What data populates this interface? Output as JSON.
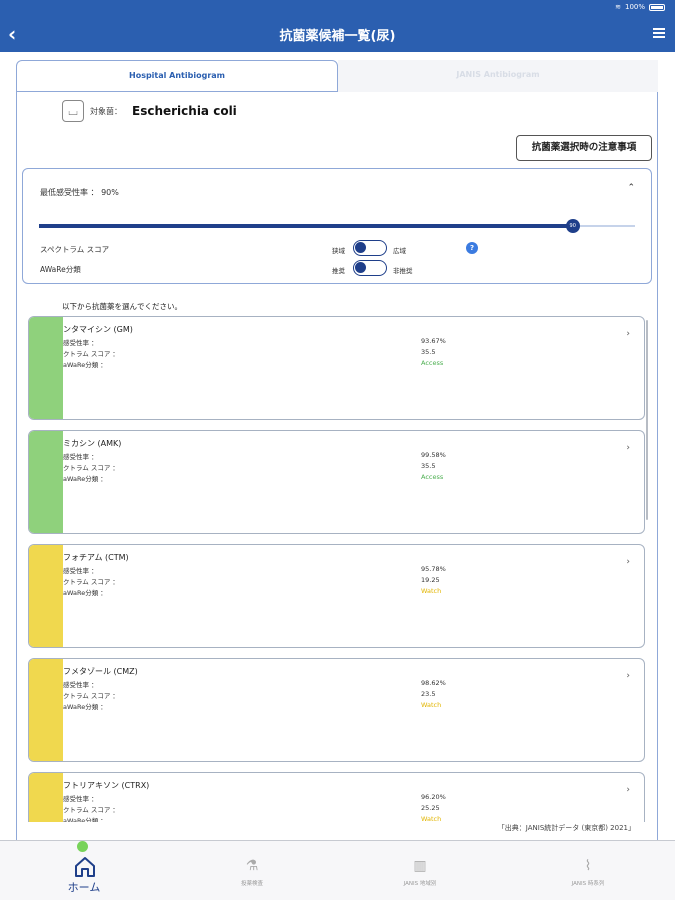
{
  "status": {
    "battery": "100%"
  },
  "nav": {
    "title": "抗菌薬候補一覧(尿)"
  },
  "tabs": [
    "Hospital Antibiogram",
    "JANIS Antibiogram"
  ],
  "organism": {
    "label": "対象菌：",
    "name": "Escherichia coli"
  },
  "caution_button": "抗菌薬選択時の注意事項",
  "filter": {
    "min_label": "最低感受性率 ： 90%",
    "slider_value": 0.9,
    "slider_thumb_text": "90",
    "spectrum_label": "スペクトラム スコア",
    "spectrum_left": "狭域",
    "spectrum_right": "広域",
    "aware_label": "AWaRe分類",
    "aware_left": "推奨",
    "aware_right": "非推奨"
  },
  "choose_text": "以下から抗菌薬を選んでください。",
  "field_labels": {
    "susceptibility": "感受性率 ：",
    "spectrum": "スペクトラム スコア ：",
    "aware": "aWaRe分類 ："
  },
  "cards": [
    {
      "name": "ンタマイシン (GM)",
      "s1": "93.67%",
      "s2": "35.5",
      "s3": "Access",
      "color": "#8fd17c",
      "aware_color": "#4caf50",
      "l1": "感受性率 ：",
      "l2": "クトラム スコア ：",
      "l3": "aWaRe分類 ："
    },
    {
      "name": "ミカシン (AMK)",
      "s1": "99.58%",
      "s2": "35.5",
      "s3": "Access",
      "color": "#8fd17c",
      "aware_color": "#4caf50",
      "l1": "感受性率 ：",
      "l2": "クトラム スコア ：",
      "l3": "aWaRe分類 ："
    },
    {
      "name": "フォチアム (CTM)",
      "s1": "95.78%",
      "s2": "19.25",
      "s3": "Watch",
      "color": "#f0d84e",
      "aware_color": "#e2b500",
      "l1": "感受性率 ：",
      "l2": "クトラム スコア ：",
      "l3": "aWaRe分類 ："
    },
    {
      "name": "フメタゾール (CMZ)",
      "s1": "98.62%",
      "s2": "23.5",
      "s3": "Watch",
      "color": "#f0d84e",
      "aware_color": "#e2b500",
      "l1": "感受性率 ：",
      "l2": "クトラム スコア ：",
      "l3": "aWaRe分類 ："
    },
    {
      "name": "フトリアキソン (CTRX)",
      "s1": "96.20%",
      "s2": "25.25",
      "s3": "Watch",
      "color": "#f0d84e",
      "aware_color": "#e2b500",
      "l1": "感受性率 ：",
      "l2": "クトラム スコア ：",
      "l3": "aWaRe分類 ："
    }
  ],
  "source": "「出典：JANIS統計データ (東京都) 2021」",
  "tabbar": [
    {
      "label": "ホーム"
    },
    {
      "label": "投薬検査"
    },
    {
      "label": "JANIS 地域別"
    },
    {
      "label": "JANIS 時系列"
    }
  ]
}
